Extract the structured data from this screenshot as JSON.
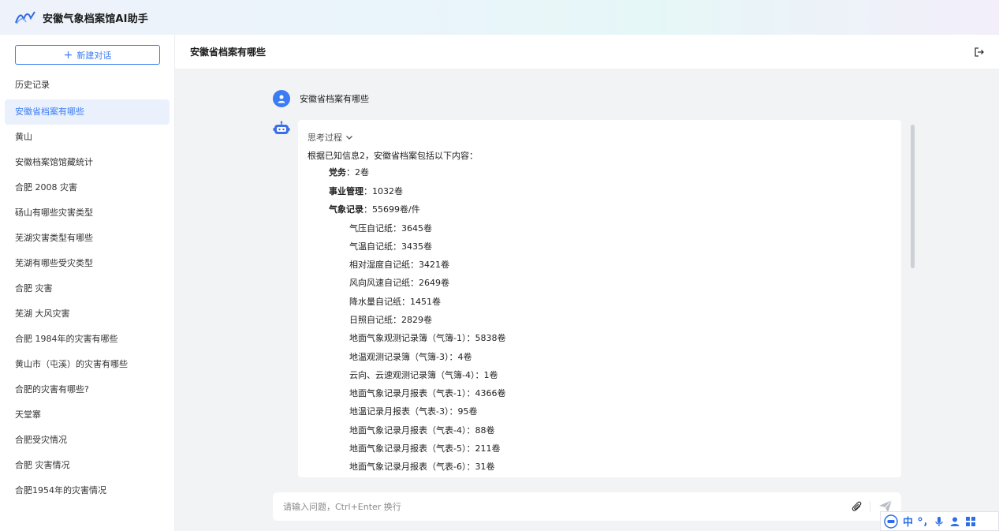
{
  "app": {
    "title": "安徽气象档案馆AI助手"
  },
  "sidebar": {
    "new_chat_label": "新建对话",
    "history_title": "历史记录",
    "items": [
      {
        "label": "安徽省档案有哪些",
        "active": true
      },
      {
        "label": "黄山"
      },
      {
        "label": "安徽档案馆馆藏统计"
      },
      {
        "label": "合肥 2008 灾害"
      },
      {
        "label": "砀山有哪些灾害类型"
      },
      {
        "label": "芜湖灾害类型有哪些"
      },
      {
        "label": "芜湖有哪些受灾类型"
      },
      {
        "label": "合肥 灾害"
      },
      {
        "label": "芜湖 大风灾害"
      },
      {
        "label": "合肥 1984年的灾害有哪些"
      },
      {
        "label": "黄山市（屯溪）的灾害有哪些"
      },
      {
        "label": "合肥的灾害有哪些?"
      },
      {
        "label": "天堂寨"
      },
      {
        "label": "合肥受灾情况"
      },
      {
        "label": "合肥 灾害情况"
      },
      {
        "label": "合肥1954年的灾害情况"
      }
    ]
  },
  "chat": {
    "title": "安徽省档案有哪些",
    "user_message": "安徽省档案有哪些",
    "think_label": "思考过程",
    "answer_intro": "根据已知信息2，安徽省档案包括以下内容：",
    "level1": [
      {
        "name": "党务",
        "value": "：2卷"
      },
      {
        "name": "事业管理",
        "value": "：1032卷"
      },
      {
        "name": "气象记录",
        "value": "：55699卷/件"
      }
    ],
    "level2": [
      "气压自记纸：3645卷",
      "气温自记纸：3435卷",
      "相对湿度自记纸：3421卷",
      "风向风速自记纸：2649卷",
      "降水量自记纸：1451卷",
      "日照自记纸：2829卷",
      "地面气象观测记录簿（气簿-1）：5838卷",
      "地温观测记录簿（气簿-3）：4卷",
      "云向、云速观测记录簿（气簿-4）：1卷",
      "地面气象记录月报表（气表-1）：4366卷",
      "地温记录月报表（气表-3）：95卷",
      "地面气象记录月报表（气表-4）：88卷",
      "地面气象记录月报表（气表-5）：211卷",
      "地面气象记录月报表（气表-6）：31卷"
    ]
  },
  "input": {
    "placeholder": "请输入问题，Ctrl+Enter 换行"
  },
  "ime": {
    "mode_label": "中"
  },
  "colors": {
    "accent": "#3b7cf4",
    "background": "#f2f3f5"
  }
}
